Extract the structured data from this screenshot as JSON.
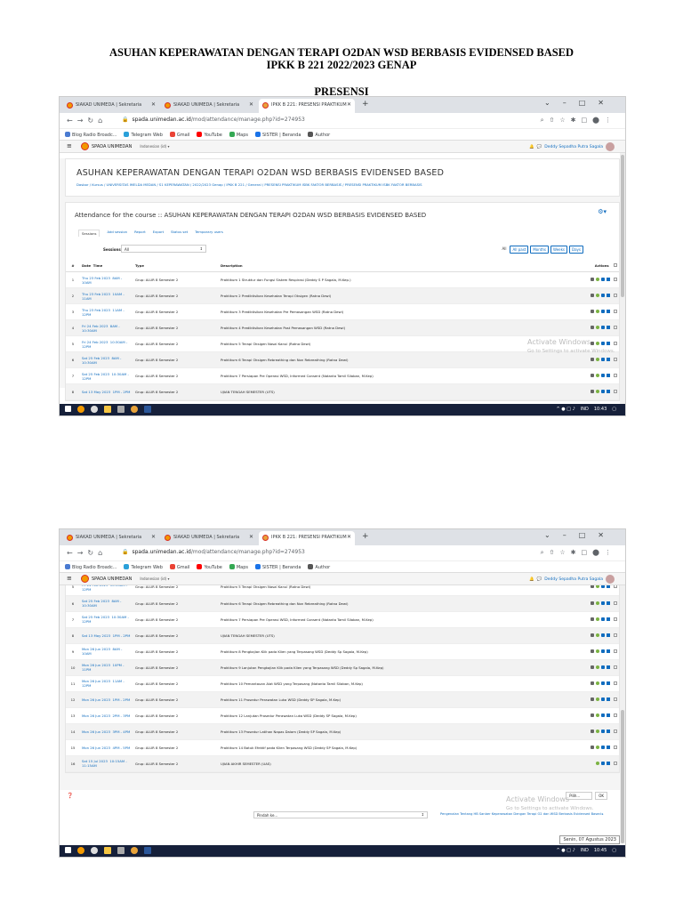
{
  "document": {
    "title_line1": "ASUHAN KEPERAWATAN DENGAN TERAPI O2DAN WSD BERBASIS EVIDENSED BASED",
    "title_line2": "IPKK B 221 2022/2023 GENAP",
    "section": "PRESENSI"
  },
  "browser": {
    "tabs": [
      "SIAKAD UNIMEDA | Sekretaria",
      "SIAKAD UNIMEDA | Sekretaria",
      "IPKK B 221: PRESENSI PRAKTIKUM"
    ],
    "url_domain": "spada.unimedan.ac.id",
    "url_path": "/mod/attendance/manage.php?id=274953",
    "bookmarks": [
      "Blog Radio Broadc...",
      "Telegram Web",
      "Gmail",
      "YouTube",
      "Maps",
      "SISTER | Beranda",
      "Author"
    ],
    "bookmark_colors": [
      "#4a7bd1",
      "#2aa0d9",
      "#ea4335",
      "#ff0000",
      "#34a853",
      "#1a73e8",
      "#555555"
    ]
  },
  "site": {
    "brand": "SPADA UNIMEDAN",
    "language": "Indonesian (id) ▾",
    "user": "Deddy Sepadha Putra Sagala"
  },
  "course": {
    "title": "ASUHAN KEPERAWATAN DENGAN TERAPI O2DAN WSD BERBASIS EVIDENSED BASED",
    "breadcrumb": "Dasbor / Kursus / UNIVERSITAS IMELDA MEDAN / S1 KEPERAWATAN / 2022/2023 Genap / IPKK B 221 / General / PRESENSI PRAKTIKUM ISBK FAKTOR BERBASIS / PRESENSI PRAKTIKUM ISBK FAKTOR BERBASIS"
  },
  "attendance": {
    "heading": "Attendance for the course :: ASUHAN KEPERAWATAN DENGAN TERAPI O2DAN WSD BERBASIS EVIDENSED BASED",
    "tabs": [
      "Sessions",
      "Add session",
      "Report",
      "Export",
      "Status set",
      "Temporary users"
    ],
    "sessions_label": "Sessions",
    "sessions_value": "All",
    "filters": [
      "All",
      "All past",
      "Months",
      "Weeks",
      "Days"
    ],
    "columns": [
      "#",
      "Date",
      "Time",
      "Type",
      "Description",
      "Actions"
    ]
  },
  "sessions": [
    {
      "n": "1",
      "date": "Thu 23 Feb 2023",
      "time": "8AM - 10AM",
      "type": "Grup: ALUR 8 Semester 2",
      "desc": "Praktikum 1 Struktur dan Fungsi Sistem Respirasi (Deddy S P Sagala, M.Kep.)"
    },
    {
      "n": "2",
      "date": "Thu 23 Feb 2023",
      "time": "10AM - 11AM",
      "type": "Grup: ALUR 8 Semester 2",
      "desc": "Praktikum 2 Prediktisikan Kesehatan Terapi Oksigen (Ratna Dewi)"
    },
    {
      "n": "3",
      "date": "Thu 23 Feb 2023",
      "time": "11AM - 12PM",
      "type": "Grup: ALUR 8 Semester 2",
      "desc": "Praktikum 3 Prediktisikan Kesehatan Pre Pemasangan WSD (Ratna Dewi)"
    },
    {
      "n": "4",
      "date": "Fri 24 Feb 2023",
      "time": "8AM - 10:30AM",
      "type": "Grup: ALUR 8 Semester 2",
      "desc": "Praktikum 4 Prediktisikan Kesehatan Post Pemasangan WSD (Ratna Dewi)"
    },
    {
      "n": "5",
      "date": "Fri 24 Feb 2023",
      "time": "10:30AM - 12PM",
      "type": "Grup: ALUR 8 Semester 2",
      "desc": "Praktikum 5 Terapi Oksigen Nasal Kanul (Ratna Dewi)"
    },
    {
      "n": "6",
      "date": "Sat 25 Feb 2023",
      "time": "8AM - 10:30AM",
      "type": "Grup: ALUR 8 Semester 2",
      "desc": "Praktikum 6 Terapi Oksigen Rebreathing dan Non Rebreathing (Ratna Dewi)"
    },
    {
      "n": "7",
      "date": "Sat 25 Feb 2023",
      "time": "10:30AM - 12PM",
      "type": "Grup: ALUR 8 Semester 2",
      "desc": "Praktikum 7 Persiapan Pre Operasi WSD, Informed Consent (Natanta Tamil Silaban, M.Kep)"
    },
    {
      "n": "8",
      "date": "Sat 13 May 2023",
      "time": "1PM - 2PM",
      "type": "Grup: ALUR 8 Semester 2",
      "desc": "UJIAN TENGAH SEMESTER (UTS)"
    },
    {
      "n": "9",
      "date": "Mon 26 Jun 2023",
      "time": "8AM - 10AM",
      "type": "Grup: ALUR 8 Semester 2",
      "desc": "Praktikum 8 Pengkajian Klik pada Klien yang Terpasang WSD (Deddy Sp Sagala, M.Kep)"
    },
    {
      "n": "10",
      "date": "Mon 26 Jun 2023",
      "time": "10PM - 11PM",
      "type": "Grup: ALUR 8 Semester 2",
      "desc": "Praktikum 9 Lanjutan Pengkajian Klik pada Klien yang Terpasang WSD (Deddy Sp Sagala, M.Kep)"
    },
    {
      "n": "11",
      "date": "Mon 26 Jun 2023",
      "time": "11AM - 12PM",
      "type": "Grup: ALUR 8 Semester 2",
      "desc": "Praktikum 10 Pemantauan Alat WSD yang Terpasang (Natanta Tamil Silaban, M.Kep)"
    },
    {
      "n": "12",
      "date": "Mon 26 Jun 2023",
      "time": "1PM - 2PM",
      "type": "Grup: ALUR 8 Semester 2",
      "desc": "Praktikum 11 Prosedur Perawatan Luka WSD (Deddy SP Sagala, M.Kep)"
    },
    {
      "n": "13",
      "date": "Mon 26 Jun 2023",
      "time": "2PM - 3PM",
      "type": "Grup: ALUR 8 Semester 2",
      "desc": "Praktikum 12 Lanjutan Prosedur Perawatan Luka WSD (Deddy SP Sagala, M.Kep)"
    },
    {
      "n": "14",
      "date": "Mon 26 Jun 2023",
      "time": "3PM - 4PM",
      "type": "Grup: ALUR 8 Semester 2",
      "desc": "Praktikum 13 Prosedur Latihan Napas Dalam (Deddy SP Sagala, M.Kep)"
    },
    {
      "n": "15",
      "date": "Mon 26 Jun 2023",
      "time": "4PM - 5PM",
      "type": "Grup: ALUR 8 Semester 2",
      "desc": "Praktikum 14 Batuk Efektif pada Klien Terpasang WSD (Deddy SP Sagala, M.Kep)"
    },
    {
      "n": "16",
      "date": "Sat 15 Jul 2023",
      "time": "10:15AM - 11:15AM",
      "type": "Grup: ALUR 8 Semester 2",
      "desc": "UJIAN AKHIR SEMESTER (UAS)"
    }
  ],
  "windows_watermark": {
    "line1": "Activate Windows",
    "line2": "Go to Settings to activate Windows."
  },
  "bottom": {
    "jump_to": "Pindah ke...",
    "next_link": "Pengenalan Tentang HB Sanber Keperawatan Dengan Terapi O2 dan WSD Berbasis Evidensed Based ▸",
    "select_label": "Pilih...",
    "ok_label": "OK"
  },
  "taskbar": {
    "lang": "IND",
    "time1": "10:43",
    "time2": "10:45",
    "tooltip": "Senin, 07 Agustus 2023"
  }
}
